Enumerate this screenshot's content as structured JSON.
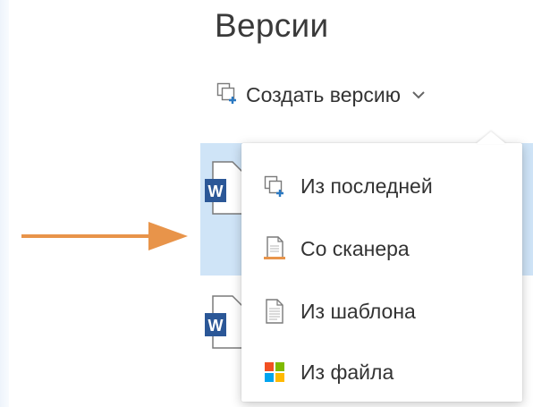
{
  "panel": {
    "title": "Версии"
  },
  "toolbar": {
    "create_label": "Создать версию"
  },
  "menu": {
    "items": [
      {
        "label": "Из последней",
        "icon": "copy-plus-icon"
      },
      {
        "label": "Со сканера",
        "icon": "scanner-icon"
      },
      {
        "label": "Из шаблона",
        "icon": "template-document-icon"
      },
      {
        "label": "Из файла",
        "icon": "windows-file-icon"
      }
    ]
  },
  "colors": {
    "selection": "#cfe4f7",
    "accent": "#2b79c2",
    "word_blue": "#2b5797",
    "annotation_arrow": "#e8944a"
  }
}
